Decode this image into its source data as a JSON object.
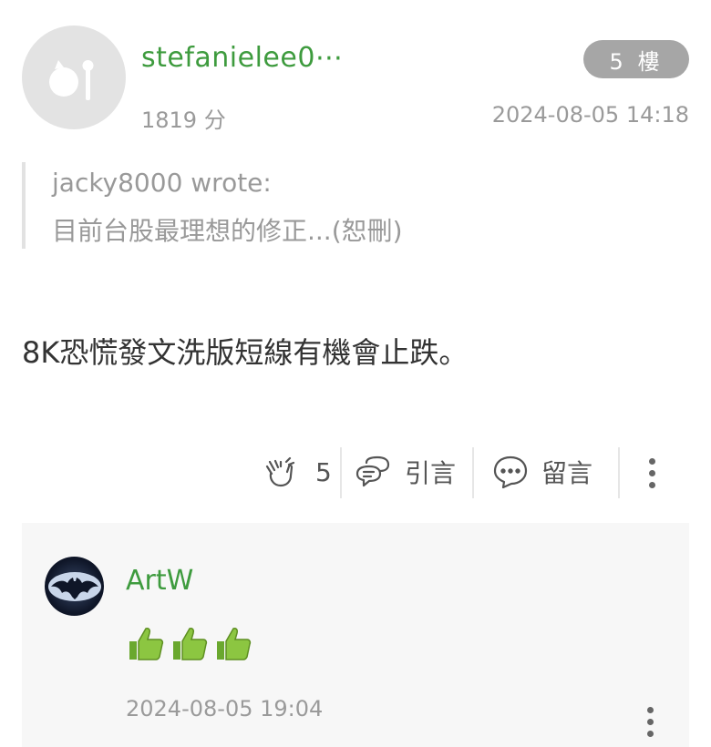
{
  "post": {
    "username": "stefanielee0⋯",
    "floor": "5 樓",
    "points": "1819 分",
    "timestamp": "2024-08-05 14:18",
    "quote": {
      "author": "jacky8000 wrote:",
      "text": "目前台股最理想的修正...(恕刪)"
    },
    "body": "8K恐慌發文洗版短線有機會止跌。",
    "actions": {
      "like_count": "5",
      "quote_label": "引言",
      "comment_label": "留言"
    }
  },
  "comment": {
    "username": "ArtW",
    "emoji_count": 3,
    "timestamp": "2024-08-05 19:04"
  },
  "colors": {
    "username": "#3e9b3e",
    "badge": "#a6a6a6",
    "muted": "#9a9a9a",
    "comment_bg": "#f7f7f7"
  }
}
